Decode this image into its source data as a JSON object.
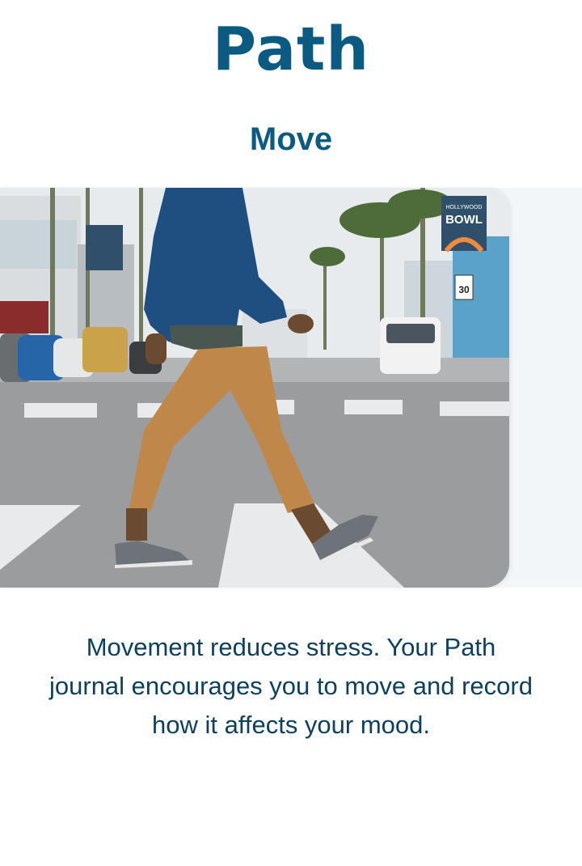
{
  "brand": {
    "logo_text": "Path",
    "color": "#0a5a82"
  },
  "screen": {
    "title": "Move",
    "description": "Movement reduces stress. Your Path journal encourages you to move and record how it affects your mood."
  },
  "photo": {
    "sign_bowl_line1": "HOLLYWOOD",
    "sign_bowl_line2": "BOWL",
    "speed_limit_number": "30"
  }
}
